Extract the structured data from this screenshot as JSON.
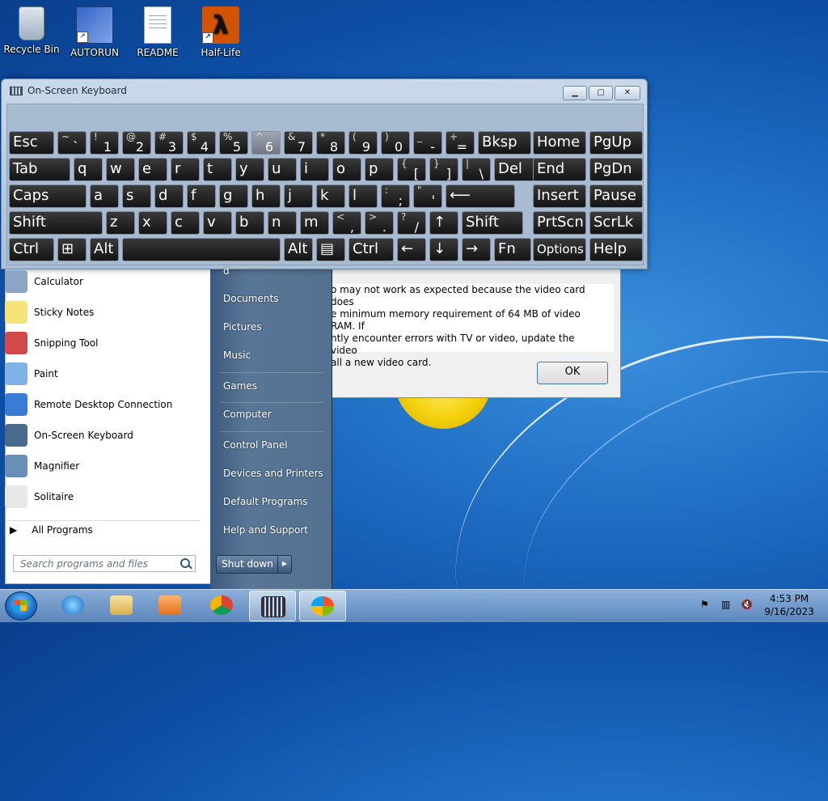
{
  "desktop": {
    "icons": [
      "Recycle Bin",
      "AUTORUN",
      "README",
      "Half-Life"
    ]
  },
  "osk": {
    "title": "On-Screen Keyboard",
    "rows": [
      [
        [
          "Esc",
          ""
        ],
        [
          "`",
          "~"
        ],
        [
          "1",
          "!"
        ],
        [
          "2",
          "@"
        ],
        [
          "3",
          "#"
        ],
        [
          "4",
          "$"
        ],
        [
          "5",
          "%"
        ],
        [
          "6",
          "^"
        ],
        [
          "7",
          "&"
        ],
        [
          "8",
          "*"
        ],
        [
          "9",
          "("
        ],
        [
          "0",
          ")"
        ],
        [
          "-",
          "_"
        ],
        [
          "=",
          "+"
        ],
        [
          "Bksp",
          ""
        ],
        [
          "Home",
          ""
        ],
        [
          "PgUp",
          ""
        ]
      ],
      [
        [
          "Tab",
          ""
        ],
        [
          "q",
          ""
        ],
        [
          "w",
          ""
        ],
        [
          "e",
          ""
        ],
        [
          "r",
          ""
        ],
        [
          "t",
          ""
        ],
        [
          "y",
          ""
        ],
        [
          "u",
          ""
        ],
        [
          "i",
          ""
        ],
        [
          "o",
          ""
        ],
        [
          "p",
          ""
        ],
        [
          "[",
          "{"
        ],
        [
          "]",
          "}"
        ],
        [
          "\\",
          "|"
        ],
        [
          "Del",
          ""
        ],
        [
          "End",
          ""
        ],
        [
          "PgDn",
          ""
        ]
      ],
      [
        [
          "Caps",
          ""
        ],
        [
          "a",
          ""
        ],
        [
          "s",
          ""
        ],
        [
          "d",
          ""
        ],
        [
          "f",
          ""
        ],
        [
          "g",
          ""
        ],
        [
          "h",
          ""
        ],
        [
          "j",
          ""
        ],
        [
          "k",
          ""
        ],
        [
          "l",
          ""
        ],
        [
          ";",
          ":"
        ],
        [
          "'",
          "\""
        ],
        [
          "⟵",
          ""
        ],
        [
          "Insert",
          ""
        ],
        [
          "Pause",
          ""
        ]
      ],
      [
        [
          "Shift",
          ""
        ],
        [
          "z",
          ""
        ],
        [
          "x",
          ""
        ],
        [
          "c",
          ""
        ],
        [
          "v",
          ""
        ],
        [
          "b",
          ""
        ],
        [
          "n",
          ""
        ],
        [
          "m",
          ""
        ],
        [
          ",",
          "<"
        ],
        [
          ".",
          ">"
        ],
        [
          "/",
          "?"
        ],
        [
          "↑",
          ""
        ],
        [
          "Shift",
          ""
        ],
        [
          "PrtScn",
          ""
        ],
        [
          "ScrLk",
          ""
        ]
      ],
      [
        [
          "Ctrl",
          ""
        ],
        [
          "⊞",
          ""
        ],
        [
          "Alt",
          ""
        ],
        [
          "",
          ""
        ],
        [
          "Alt",
          ""
        ],
        [
          "▤",
          ""
        ],
        [
          "Ctrl",
          ""
        ],
        [
          "←",
          ""
        ],
        [
          "↓",
          ""
        ],
        [
          "→",
          ""
        ],
        [
          "Fn",
          ""
        ],
        [
          "Options",
          ""
        ],
        [
          "Help",
          ""
        ]
      ]
    ]
  },
  "dialog": {
    "text_lines": [
      "o may not work as expected because the video card does",
      "e minimum memory requirement of 64 MB of video RAM. If",
      "ntly encounter errors with TV or video, update the video",
      "all a new video card."
    ],
    "ok_label": "OK"
  },
  "start_menu": {
    "programs": [
      "Calculator",
      "Sticky Notes",
      "Snipping Tool",
      "Paint",
      "Remote Desktop Connection",
      "On-Screen Keyboard",
      "Magnifier",
      "Solitaire"
    ],
    "all_programs": "All Programs",
    "search_placeholder": "Search programs and files",
    "right_items": [
      "d",
      "Documents",
      "Pictures",
      "Music",
      "Games",
      "Computer",
      "Control Panel",
      "Devices and Printers",
      "Default Programs",
      "Help and Support"
    ],
    "shutdown_label": "Shut down"
  },
  "taskbar": {
    "time": "4:53 PM",
    "date": "9/16/2023"
  }
}
